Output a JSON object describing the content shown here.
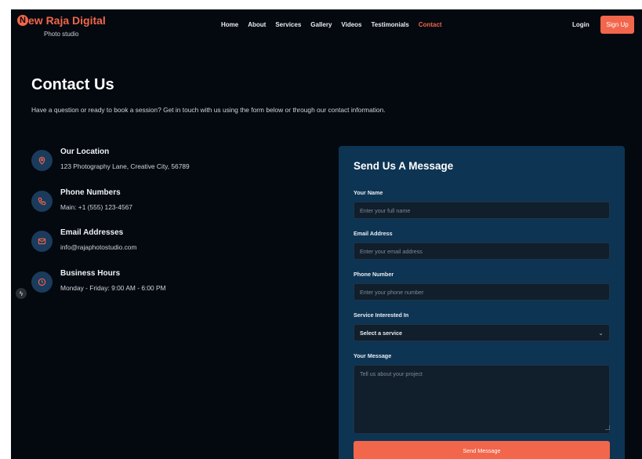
{
  "brand": {
    "initial": "N",
    "name": "New Raja Digital",
    "name_rest": "ew Raja Digital",
    "tagline": "Photo studio"
  },
  "nav": {
    "items": [
      {
        "label": "Home",
        "active": false
      },
      {
        "label": "About",
        "active": false
      },
      {
        "label": "Services",
        "active": false
      },
      {
        "label": "Gallery",
        "active": false
      },
      {
        "label": "Videos",
        "active": false
      },
      {
        "label": "Testimonials",
        "active": false
      },
      {
        "label": "Contact",
        "active": true
      }
    ],
    "login": "Login",
    "signup": "Sign Up"
  },
  "hero": {
    "title": "Contact Us",
    "description": "Have a question or ready to book a session? Get in touch with us using the form below or through our contact information."
  },
  "contact_info": [
    {
      "icon": "location-pin-icon",
      "heading": "Our Location",
      "value": "123 Photography Lane, Creative City, 56789"
    },
    {
      "icon": "phone-icon",
      "heading": "Phone Numbers",
      "value": "Main: +1 (555) 123-4567"
    },
    {
      "icon": "mail-icon",
      "heading": "Email Addresses",
      "value": "info@rajaphotostudio.com"
    },
    {
      "icon": "clock-icon",
      "heading": "Business Hours",
      "value": "Monday - Friday: 9:00 AM - 6:00 PM"
    }
  ],
  "form": {
    "title": "Send Us A Message",
    "name_label": "Your Name",
    "name_placeholder": "Enter your full name",
    "email_label": "Email Address",
    "email_placeholder": "Enter your email address",
    "phone_label": "Phone Number",
    "phone_placeholder": "Enter your phone number",
    "service_label": "Service Interested In",
    "service_selected": "Select a service",
    "message_label": "Your Message",
    "message_placeholder": "Tell us about your project",
    "submit": "Send Message"
  },
  "colors": {
    "accent": "#f2664b",
    "background": "#04090f",
    "card": "#0e3453",
    "icon_circle": "#1b3b5c",
    "input": "#111e2b"
  }
}
